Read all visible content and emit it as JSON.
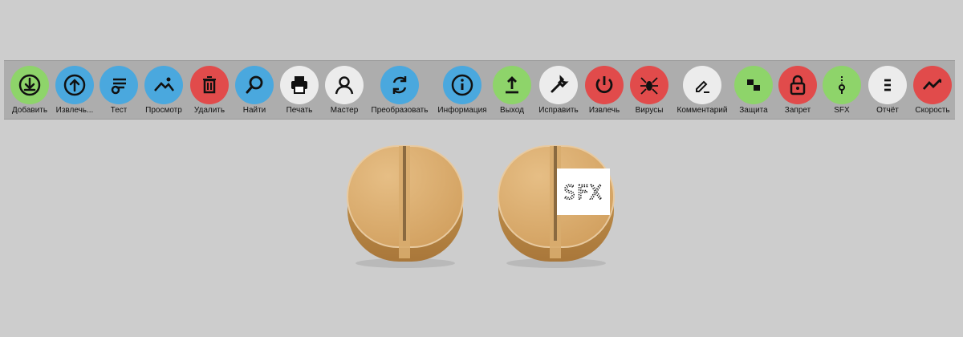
{
  "toolbar": {
    "items": [
      {
        "label": "Добавить",
        "icon": "download-icon",
        "color": "#8ed46a"
      },
      {
        "label": "Извлечь...",
        "icon": "upload-icon",
        "color": "#4aa8de"
      },
      {
        "label": "Тест",
        "icon": "test-icon",
        "color": "#4aa8de"
      },
      {
        "label": "Просмотр",
        "icon": "image-icon",
        "color": "#4aa8de"
      },
      {
        "label": "Удалить",
        "icon": "trash-icon",
        "color": "#e14b4b"
      },
      {
        "label": "Найти",
        "icon": "search-icon",
        "color": "#4aa8de"
      },
      {
        "label": "Печать",
        "icon": "printer-icon",
        "color": "#ececec"
      },
      {
        "label": "Мастер",
        "icon": "user-icon",
        "color": "#ececec"
      },
      {
        "label": "Преобразовать",
        "icon": "convert-icon",
        "color": "#4aa8de"
      },
      {
        "label": "Информация",
        "icon": "info-icon",
        "color": "#4aa8de"
      },
      {
        "label": "Выход",
        "icon": "exit-icon",
        "color": "#8ed46a"
      },
      {
        "label": "Исправить",
        "icon": "wrench-icon",
        "color": "#ececec"
      },
      {
        "label": "Извлечь",
        "icon": "power-icon",
        "color": "#e14b4b"
      },
      {
        "label": "Вирусы",
        "icon": "spider-icon",
        "color": "#e14b4b"
      },
      {
        "label": "Комментарий",
        "icon": "pencil-icon",
        "color": "#ececec"
      },
      {
        "label": "Защита",
        "icon": "shield-blocks-icon",
        "color": "#8ed46a"
      },
      {
        "label": "Запрет",
        "icon": "lock-icon",
        "color": "#e14b4b"
      },
      {
        "label": "SFX",
        "icon": "zip-icon",
        "color": "#8ed46a"
      },
      {
        "label": "Отчёт",
        "icon": "report-icon",
        "color": "#ececec"
      },
      {
        "label": "Скорость",
        "icon": "speed-icon",
        "color": "#e14b4b"
      }
    ]
  },
  "pills": {
    "sfx_label": "SFX"
  }
}
